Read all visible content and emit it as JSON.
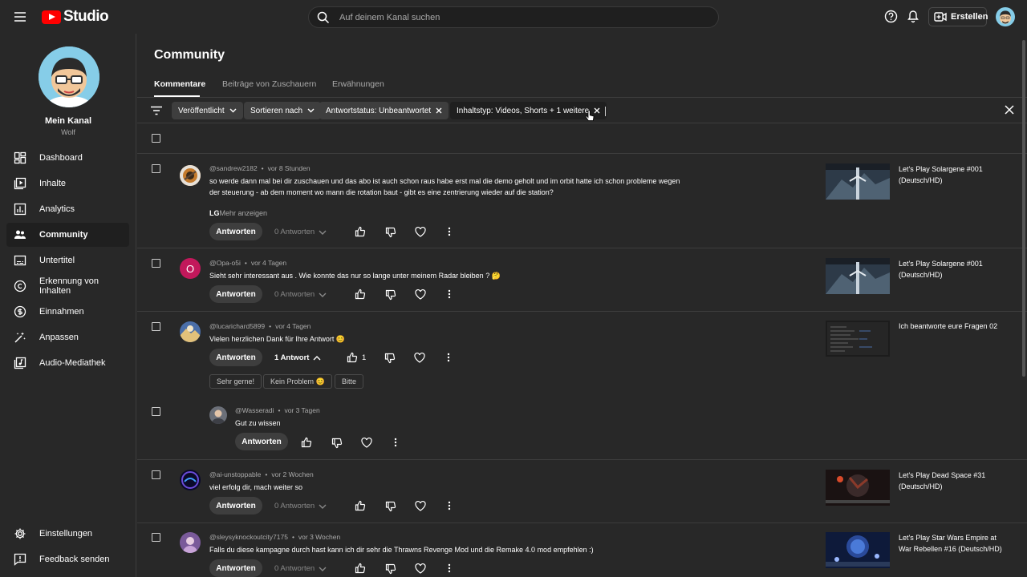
{
  "app": {
    "logo_text": "Studio",
    "brand_color": "#ff0000"
  },
  "search": {
    "placeholder": "Auf deinem Kanal suchen"
  },
  "header": {
    "create_label": "Erstellen"
  },
  "channel": {
    "name": "Mein Kanal",
    "handle": "Wolf"
  },
  "sidebar": {
    "items": [
      {
        "label": "Dashboard",
        "icon": "dashboard-icon"
      },
      {
        "label": "Inhalte",
        "icon": "content-icon"
      },
      {
        "label": "Analytics",
        "icon": "analytics-icon"
      },
      {
        "label": "Community",
        "icon": "community-icon",
        "active": true
      },
      {
        "label": "Untertitel",
        "icon": "subtitles-icon"
      },
      {
        "label": "Erkennung von Inhalten",
        "icon": "copyright-icon"
      },
      {
        "label": "Einnahmen",
        "icon": "dollar-icon"
      },
      {
        "label": "Anpassen",
        "icon": "magic-wand-icon"
      },
      {
        "label": "Audio-Mediathek",
        "icon": "audio-library-icon"
      }
    ],
    "bottom": [
      {
        "label": "Einstellungen",
        "icon": "gear-icon"
      },
      {
        "label": "Feedback senden",
        "icon": "feedback-icon"
      }
    ]
  },
  "page": {
    "title": "Community",
    "tabs": [
      "Kommentare",
      "Beiträge von Zuschauern",
      "Erwähnungen"
    ]
  },
  "filters": {
    "chips": [
      "Veröffentlicht",
      "Sortieren nach",
      "Antwortstatus: Unbeantwortet",
      "Inhaltstyp: Videos, Shorts + 1 weitere"
    ]
  },
  "comments": [
    {
      "author": "@sandrew2182",
      "time": "vor 8 Stunden",
      "text": "so werde dann mal bei dir zuschauen und das abo ist auch schon raus habe erst mal die demo geholt und im orbit hatte ich schon probleme wegen der steuerung - ab dem moment wo mann die rotation baut - gibt es eine zentrierung wieder auf die station?",
      "text_tail": "LG",
      "more": "Mehr anzeigen",
      "reply": "Antworten",
      "replies": "0 Antworten",
      "video": "Let's Play Solargene #001 (Deutsch/HD)"
    },
    {
      "author": "@Opa-o5i",
      "avatar_letter": "O",
      "time": "vor 4 Tagen",
      "text": "Sieht sehr interessant aus . Wie konnte das nur so lange unter meinem Radar bleiben ? 🤔",
      "reply": "Antworten",
      "replies": "0 Antworten",
      "video": "Let's Play Solargene #001 (Deutsch/HD)"
    },
    {
      "author": "@lucarichard5899",
      "time": "vor 4 Tagen",
      "text": "Vielen herzlichen Dank für Ihre Antwort 😊",
      "reply": "Antworten",
      "replies": "1 Antwort",
      "likes": "1",
      "quick_replies": [
        "Sehr gerne!",
        "Kein Problem 😊",
        "Bitte"
      ],
      "video": "Ich beantworte eure Fragen 02",
      "nested": {
        "author": "@Wasseradi",
        "time": "vor 3 Tagen",
        "text": "Gut zu wissen",
        "reply": "Antworten"
      }
    },
    {
      "author": "@ai-unstoppable",
      "time": "vor 2 Wochen",
      "text": "viel erfolg dir, mach weiter so",
      "reply": "Antworten",
      "replies": "0 Antworten",
      "video": "Let's Play Dead Space #31 (Deutsch/HD)"
    },
    {
      "author": "@sleysyknockoutcity7175",
      "time": "vor 3 Wochen",
      "text": "Falls du diese kampagne durch hast kann ich dir sehr die Thrawns Revenge Mod und die Remake 4.0 mod empfehlen :)",
      "reply": "Antworten",
      "replies": "0 Antworten",
      "video": "Let's Play Star Wars Empire at War Rebellen #16 (Deutsch/HD)"
    }
  ]
}
